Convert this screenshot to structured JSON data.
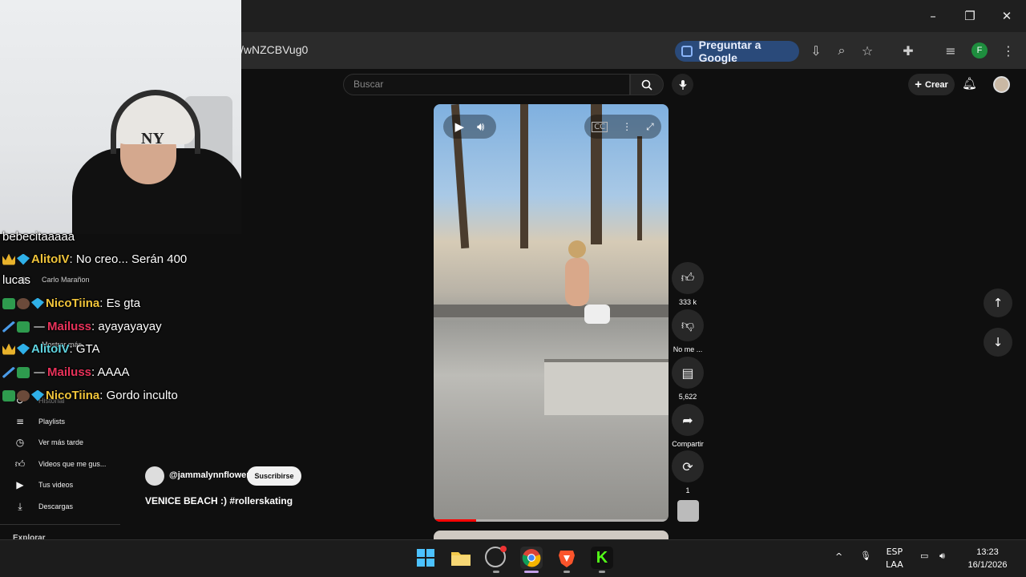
{
  "browser": {
    "url_fragment": "/wNZCBVug0",
    "ask_google": "Preguntar a Google",
    "profile_initial": "F",
    "window_controls": {
      "minimize": "–",
      "restore": "❐",
      "close": "✕"
    }
  },
  "youtube": {
    "search_placeholder": "Buscar",
    "create_label": "Crear",
    "video": {
      "channel": "@jammalynnflower",
      "subscribe_label": "Suscribirse",
      "title": "VENICE BEACH :) #rollerskating",
      "progress": 0.18
    },
    "actions": {
      "likes": "333 k",
      "dislike": "No me ...",
      "comments": "5,622",
      "share": "Compartir",
      "remix": "1"
    },
    "sidebar": {
      "items": [
        {
          "label": "Historial",
          "icon": "history-icon"
        },
        {
          "label": "Playlists",
          "icon": "playlist-icon"
        },
        {
          "label": "Ver más tarde",
          "icon": "clock-icon"
        },
        {
          "label": "Videos que me gus...",
          "icon": "thumbs-up-icon"
        },
        {
          "label": "Tus videos",
          "icon": "video-icon"
        },
        {
          "label": "Descargas",
          "icon": "download-icon"
        }
      ],
      "subs": [
        "Carlo Marañon",
        "Mostrar más"
      ],
      "explore": "Explorar"
    }
  },
  "chat": [
    {
      "user": "",
      "text": "bebecitaaaaa",
      "color": "white",
      "badges": []
    },
    {
      "user": "AlitoIV",
      "text": ": No creo... Serán 400",
      "color": "gold",
      "badges": [
        "crown",
        "gem"
      ]
    },
    {
      "user": "",
      "text": "lucas",
      "color": "white",
      "badges": []
    },
    {
      "user": "NicoTiina",
      "text": ": Es gta",
      "color": "gold",
      "badges": [
        "88",
        "emoji",
        "gem"
      ]
    },
    {
      "user": "Mailuss",
      "text": ": ayayayayay",
      "color": "red",
      "badges": [
        "sword",
        "88",
        "dash"
      ]
    },
    {
      "user": "AlitoIV",
      "text": ": GTA",
      "color": "cyan",
      "badges": [
        "crown",
        "gem"
      ]
    },
    {
      "user": "Mailuss",
      "text": ": AAAA",
      "color": "red",
      "badges": [
        "sword",
        "88",
        "dash"
      ]
    },
    {
      "user": "NicoTiina",
      "text": ": Gordo inculto",
      "color": "gold",
      "badges": [
        "88",
        "emoji",
        "gem"
      ]
    }
  ],
  "taskbar": {
    "apps": [
      "windows-start-icon",
      "file-explorer-icon",
      "obs-icon",
      "chrome-icon",
      "brave-icon",
      "kick-icon"
    ],
    "lang_top": "ESP",
    "lang_bottom": "LAA",
    "time": "13:23",
    "date": "16/1/2026"
  }
}
